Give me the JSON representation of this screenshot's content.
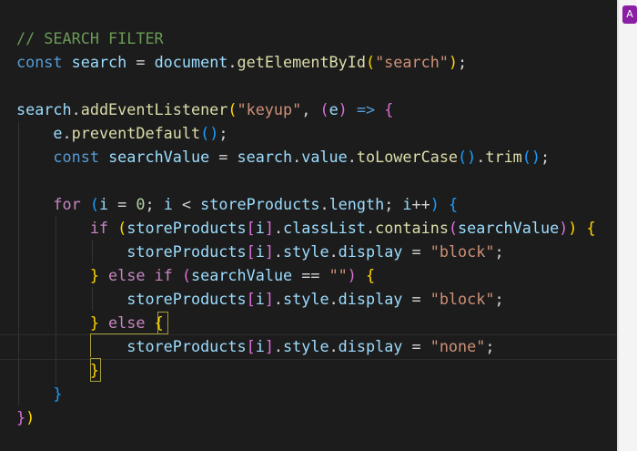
{
  "editor": {
    "lines": [
      [
        [
          "// SEARCH FILTER",
          "comment"
        ]
      ],
      [
        [
          "const",
          "kw"
        ],
        [
          " ",
          "op"
        ],
        [
          "search",
          "var"
        ],
        [
          " = ",
          "op"
        ],
        [
          "document",
          "var"
        ],
        [
          ".",
          "op"
        ],
        [
          "getElementById",
          "fn"
        ],
        [
          "(",
          "b1"
        ],
        [
          "\"search\"",
          "str"
        ],
        [
          ")",
          "b1"
        ],
        [
          ";",
          "op"
        ]
      ],
      [],
      [
        [
          "search",
          "var"
        ],
        [
          ".",
          "op"
        ],
        [
          "addEventListener",
          "fn"
        ],
        [
          "(",
          "b1"
        ],
        [
          "\"keyup\"",
          "str"
        ],
        [
          ", ",
          "op"
        ],
        [
          "(",
          "b2"
        ],
        [
          "e",
          "var"
        ],
        [
          ")",
          "b2"
        ],
        [
          " => ",
          "kw"
        ],
        [
          "{",
          "b2"
        ]
      ],
      [
        [
          "    ",
          "op"
        ],
        [
          "e",
          "var"
        ],
        [
          ".",
          "op"
        ],
        [
          "preventDefault",
          "fn"
        ],
        [
          "()",
          "b3"
        ],
        [
          ";",
          "op"
        ]
      ],
      [
        [
          "    ",
          "op"
        ],
        [
          "const",
          "kw"
        ],
        [
          " ",
          "op"
        ],
        [
          "searchValue",
          "var"
        ],
        [
          " = ",
          "op"
        ],
        [
          "search",
          "var"
        ],
        [
          ".",
          "op"
        ],
        [
          "value",
          "prop"
        ],
        [
          ".",
          "op"
        ],
        [
          "toLowerCase",
          "fn"
        ],
        [
          "()",
          "b3"
        ],
        [
          ".",
          "op"
        ],
        [
          "trim",
          "fn"
        ],
        [
          "()",
          "b3"
        ],
        [
          ";",
          "op"
        ]
      ],
      [],
      [
        [
          "    ",
          "op"
        ],
        [
          "for",
          "ctl"
        ],
        [
          " ",
          "op"
        ],
        [
          "(",
          "b3"
        ],
        [
          "i",
          "var"
        ],
        [
          " = ",
          "op"
        ],
        [
          "0",
          "num"
        ],
        [
          "; ",
          "op"
        ],
        [
          "i",
          "var"
        ],
        [
          " < ",
          "op"
        ],
        [
          "storeProducts",
          "var"
        ],
        [
          ".",
          "op"
        ],
        [
          "length",
          "prop"
        ],
        [
          "; ",
          "op"
        ],
        [
          "i",
          "var"
        ],
        [
          "++",
          "op"
        ],
        [
          ")",
          "b3"
        ],
        [
          " ",
          "op"
        ],
        [
          "{",
          "b3"
        ]
      ],
      [
        [
          "        ",
          "op"
        ],
        [
          "if",
          "ctl"
        ],
        [
          " ",
          "op"
        ],
        [
          "(",
          "b1"
        ],
        [
          "storeProducts",
          "var"
        ],
        [
          "[",
          "b2"
        ],
        [
          "i",
          "var"
        ],
        [
          "]",
          "b2"
        ],
        [
          ".",
          "op"
        ],
        [
          "classList",
          "prop"
        ],
        [
          ".",
          "op"
        ],
        [
          "contains",
          "fn"
        ],
        [
          "(",
          "b2"
        ],
        [
          "searchValue",
          "var"
        ],
        [
          ")",
          "b2"
        ],
        [
          ")",
          "b1"
        ],
        [
          " ",
          "op"
        ],
        [
          "{",
          "b1"
        ]
      ],
      [
        [
          "            ",
          "op"
        ],
        [
          "storeProducts",
          "var"
        ],
        [
          "[",
          "b2"
        ],
        [
          "i",
          "var"
        ],
        [
          "]",
          "b2"
        ],
        [
          ".",
          "op"
        ],
        [
          "style",
          "prop"
        ],
        [
          ".",
          "op"
        ],
        [
          "display",
          "prop"
        ],
        [
          " = ",
          "op"
        ],
        [
          "\"block\"",
          "str"
        ],
        [
          ";",
          "op"
        ]
      ],
      [
        [
          "        ",
          "op"
        ],
        [
          "}",
          "b1"
        ],
        [
          " ",
          "op"
        ],
        [
          "else",
          "ctl"
        ],
        [
          " ",
          "op"
        ],
        [
          "if",
          "ctl"
        ],
        [
          " ",
          "op"
        ],
        [
          "(",
          "b2"
        ],
        [
          "searchValue",
          "var"
        ],
        [
          " == ",
          "op"
        ],
        [
          "\"\"",
          "str"
        ],
        [
          ")",
          "b2"
        ],
        [
          " ",
          "op"
        ],
        [
          "{",
          "b1"
        ]
      ],
      [
        [
          "            ",
          "op"
        ],
        [
          "storeProducts",
          "var"
        ],
        [
          "[",
          "b2"
        ],
        [
          "i",
          "var"
        ],
        [
          "]",
          "b2"
        ],
        [
          ".",
          "op"
        ],
        [
          "style",
          "prop"
        ],
        [
          ".",
          "op"
        ],
        [
          "display",
          "prop"
        ],
        [
          " = ",
          "op"
        ],
        [
          "\"block\"",
          "str"
        ],
        [
          ";",
          "op"
        ]
      ],
      [
        [
          "        ",
          "op"
        ],
        [
          "}",
          "b1"
        ],
        [
          " ",
          "op"
        ],
        [
          "else",
          "ctl"
        ],
        [
          " ",
          "op"
        ],
        [
          "{",
          "b1"
        ]
      ],
      [
        [
          "            ",
          "op"
        ],
        [
          "storeProducts",
          "var"
        ],
        [
          "[",
          "b2"
        ],
        [
          "i",
          "var"
        ],
        [
          "]",
          "b2"
        ],
        [
          ".",
          "op"
        ],
        [
          "style",
          "prop"
        ],
        [
          ".",
          "op"
        ],
        [
          "display",
          "prop"
        ],
        [
          " = ",
          "op"
        ],
        [
          "\"none\"",
          "str"
        ],
        [
          ";",
          "op"
        ]
      ],
      [
        [
          "        ",
          "op"
        ],
        [
          "}",
          "b1"
        ]
      ],
      [
        [
          "    ",
          "op"
        ],
        [
          "}",
          "b3"
        ]
      ],
      [
        [
          "}",
          "b2"
        ],
        [
          ")",
          "b1"
        ]
      ]
    ]
  },
  "side_panel": {
    "badge_letter": "A",
    "badge_color": "#8a1fa3"
  }
}
